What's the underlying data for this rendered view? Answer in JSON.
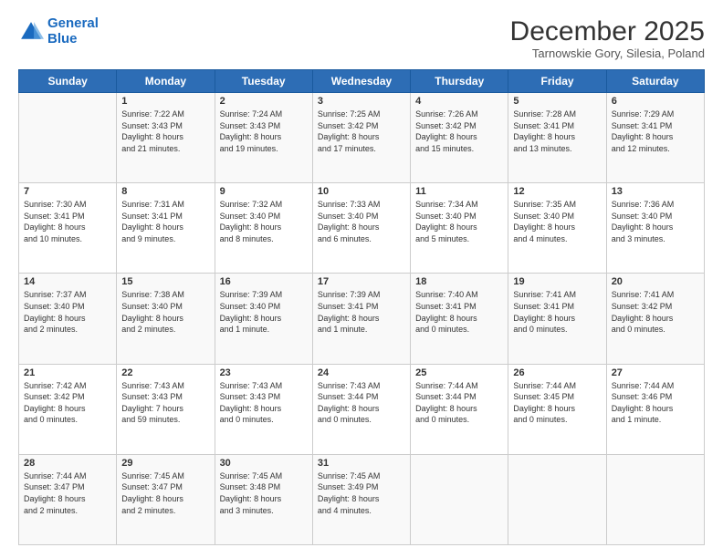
{
  "header": {
    "logo_line1": "General",
    "logo_line2": "Blue",
    "month": "December 2025",
    "location": "Tarnowskie Gory, Silesia, Poland"
  },
  "days_of_week": [
    "Sunday",
    "Monday",
    "Tuesday",
    "Wednesday",
    "Thursday",
    "Friday",
    "Saturday"
  ],
  "weeks": [
    [
      {
        "day": "",
        "info": ""
      },
      {
        "day": "1",
        "info": "Sunrise: 7:22 AM\nSunset: 3:43 PM\nDaylight: 8 hours\nand 21 minutes."
      },
      {
        "day": "2",
        "info": "Sunrise: 7:24 AM\nSunset: 3:43 PM\nDaylight: 8 hours\nand 19 minutes."
      },
      {
        "day": "3",
        "info": "Sunrise: 7:25 AM\nSunset: 3:42 PM\nDaylight: 8 hours\nand 17 minutes."
      },
      {
        "day": "4",
        "info": "Sunrise: 7:26 AM\nSunset: 3:42 PM\nDaylight: 8 hours\nand 15 minutes."
      },
      {
        "day": "5",
        "info": "Sunrise: 7:28 AM\nSunset: 3:41 PM\nDaylight: 8 hours\nand 13 minutes."
      },
      {
        "day": "6",
        "info": "Sunrise: 7:29 AM\nSunset: 3:41 PM\nDaylight: 8 hours\nand 12 minutes."
      }
    ],
    [
      {
        "day": "7",
        "info": "Sunrise: 7:30 AM\nSunset: 3:41 PM\nDaylight: 8 hours\nand 10 minutes."
      },
      {
        "day": "8",
        "info": "Sunrise: 7:31 AM\nSunset: 3:41 PM\nDaylight: 8 hours\nand 9 minutes."
      },
      {
        "day": "9",
        "info": "Sunrise: 7:32 AM\nSunset: 3:40 PM\nDaylight: 8 hours\nand 8 minutes."
      },
      {
        "day": "10",
        "info": "Sunrise: 7:33 AM\nSunset: 3:40 PM\nDaylight: 8 hours\nand 6 minutes."
      },
      {
        "day": "11",
        "info": "Sunrise: 7:34 AM\nSunset: 3:40 PM\nDaylight: 8 hours\nand 5 minutes."
      },
      {
        "day": "12",
        "info": "Sunrise: 7:35 AM\nSunset: 3:40 PM\nDaylight: 8 hours\nand 4 minutes."
      },
      {
        "day": "13",
        "info": "Sunrise: 7:36 AM\nSunset: 3:40 PM\nDaylight: 8 hours\nand 3 minutes."
      }
    ],
    [
      {
        "day": "14",
        "info": "Sunrise: 7:37 AM\nSunset: 3:40 PM\nDaylight: 8 hours\nand 2 minutes."
      },
      {
        "day": "15",
        "info": "Sunrise: 7:38 AM\nSunset: 3:40 PM\nDaylight: 8 hours\nand 2 minutes."
      },
      {
        "day": "16",
        "info": "Sunrise: 7:39 AM\nSunset: 3:40 PM\nDaylight: 8 hours\nand 1 minute."
      },
      {
        "day": "17",
        "info": "Sunrise: 7:39 AM\nSunset: 3:41 PM\nDaylight: 8 hours\nand 1 minute."
      },
      {
        "day": "18",
        "info": "Sunrise: 7:40 AM\nSunset: 3:41 PM\nDaylight: 8 hours\nand 0 minutes."
      },
      {
        "day": "19",
        "info": "Sunrise: 7:41 AM\nSunset: 3:41 PM\nDaylight: 8 hours\nand 0 minutes."
      },
      {
        "day": "20",
        "info": "Sunrise: 7:41 AM\nSunset: 3:42 PM\nDaylight: 8 hours\nand 0 minutes."
      }
    ],
    [
      {
        "day": "21",
        "info": "Sunrise: 7:42 AM\nSunset: 3:42 PM\nDaylight: 8 hours\nand 0 minutes."
      },
      {
        "day": "22",
        "info": "Sunrise: 7:43 AM\nSunset: 3:43 PM\nDaylight: 7 hours\nand 59 minutes."
      },
      {
        "day": "23",
        "info": "Sunrise: 7:43 AM\nSunset: 3:43 PM\nDaylight: 8 hours\nand 0 minutes."
      },
      {
        "day": "24",
        "info": "Sunrise: 7:43 AM\nSunset: 3:44 PM\nDaylight: 8 hours\nand 0 minutes."
      },
      {
        "day": "25",
        "info": "Sunrise: 7:44 AM\nSunset: 3:44 PM\nDaylight: 8 hours\nand 0 minutes."
      },
      {
        "day": "26",
        "info": "Sunrise: 7:44 AM\nSunset: 3:45 PM\nDaylight: 8 hours\nand 0 minutes."
      },
      {
        "day": "27",
        "info": "Sunrise: 7:44 AM\nSunset: 3:46 PM\nDaylight: 8 hours\nand 1 minute."
      }
    ],
    [
      {
        "day": "28",
        "info": "Sunrise: 7:44 AM\nSunset: 3:47 PM\nDaylight: 8 hours\nand 2 minutes."
      },
      {
        "day": "29",
        "info": "Sunrise: 7:45 AM\nSunset: 3:47 PM\nDaylight: 8 hours\nand 2 minutes."
      },
      {
        "day": "30",
        "info": "Sunrise: 7:45 AM\nSunset: 3:48 PM\nDaylight: 8 hours\nand 3 minutes."
      },
      {
        "day": "31",
        "info": "Sunrise: 7:45 AM\nSunset: 3:49 PM\nDaylight: 8 hours\nand 4 minutes."
      },
      {
        "day": "",
        "info": ""
      },
      {
        "day": "",
        "info": ""
      },
      {
        "day": "",
        "info": ""
      }
    ]
  ]
}
